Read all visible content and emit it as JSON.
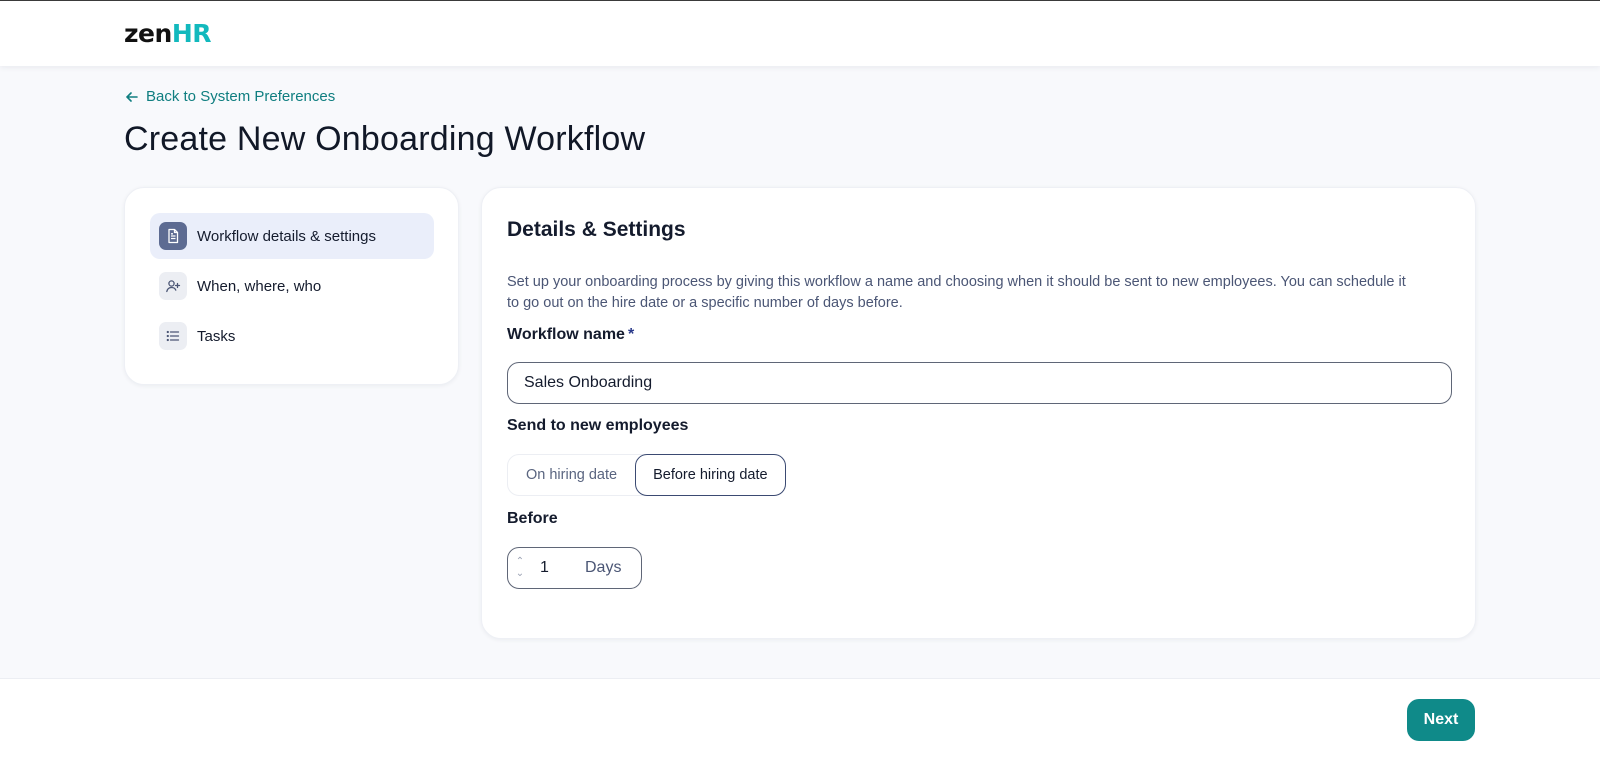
{
  "header": {
    "logo_part1": "zen",
    "logo_part2": "HR"
  },
  "page": {
    "back_link": "Back to System Preferences",
    "title": "Create New Onboarding Workflow"
  },
  "steps": [
    {
      "label": "Workflow details & settings",
      "icon": "document-icon",
      "active": true
    },
    {
      "label": "When, where, who",
      "icon": "user-add-icon",
      "active": false
    },
    {
      "label": "Tasks",
      "icon": "list-icon",
      "active": false
    }
  ],
  "details": {
    "title": "Details & Settings",
    "description": "Set up your onboarding process by giving this workflow a name and choosing when it should be sent to new employees. You can schedule it to go out on the hire date or a specific number of days before.",
    "workflow_name_label": "Workflow name",
    "required_mark": "*",
    "workflow_name_value": "Sales Onboarding",
    "send_label": "Send to new employees",
    "send_options": [
      "On hiring date",
      "Before hiring date"
    ],
    "send_selected": "Before hiring date",
    "before_label": "Before",
    "before_value": "1",
    "before_unit": "Days"
  },
  "footer": {
    "next_label": "Next"
  },
  "colors": {
    "accent": "#0f8a89",
    "link": "#0f7e80",
    "logo_hr": "#12b9bd",
    "active_step_bg": "#eaeefa",
    "active_step_icon_bg": "#5d6b92"
  }
}
